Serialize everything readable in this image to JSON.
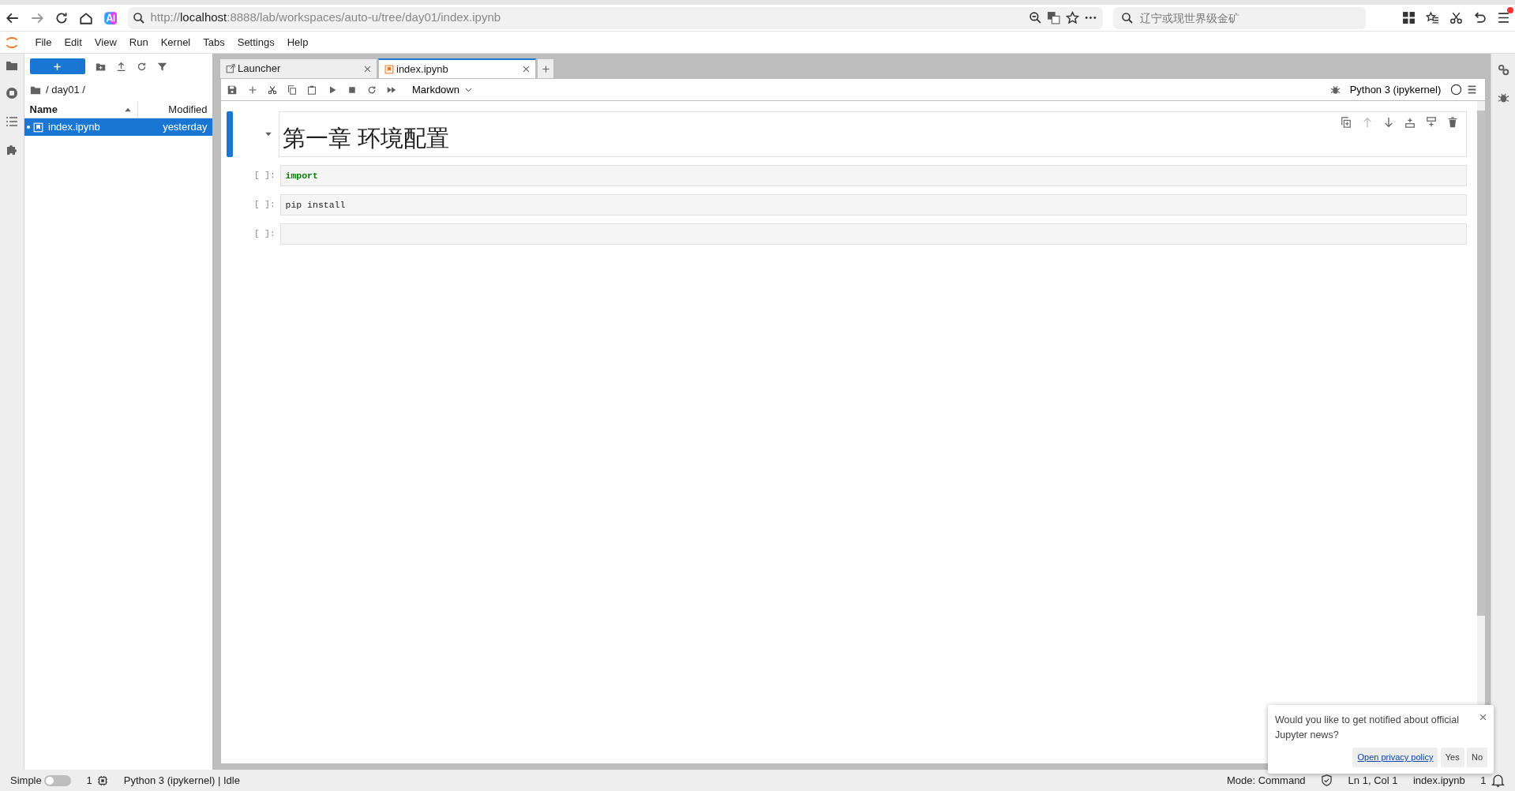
{
  "browser": {
    "address": {
      "scheme": "http://",
      "host": "localhost",
      "path": ":8888/lab/workspaces/auto-u/tree/day01/index.ipynb"
    },
    "search": {
      "placeholder": "辽宁或现世界级金矿"
    },
    "menu_badge": true
  },
  "menu": [
    "File",
    "Edit",
    "View",
    "Run",
    "Kernel",
    "Tabs",
    "Settings",
    "Help"
  ],
  "file_browser": {
    "breadcrumb": "/ day01 /",
    "columns": [
      {
        "label": "Name",
        "sorted": true
      },
      {
        "label": "Modified",
        "sorted": false
      }
    ],
    "files": [
      {
        "name": "index.ipynb",
        "modified": "yesterday",
        "selected": true,
        "running": true
      }
    ]
  },
  "tabs": [
    {
      "label": "Launcher",
      "kind": "launcher",
      "selected": false
    },
    {
      "label": "index.ipynb",
      "kind": "notebook",
      "selected": true
    }
  ],
  "toolbar": {
    "cell_type": "Markdown",
    "kernel": "Python 3 (ipykernel)"
  },
  "cells": [
    {
      "kind": "markdown",
      "text": "第一章 环境配置",
      "active": true
    },
    {
      "kind": "code",
      "prompt": "[ ]:",
      "code": "import",
      "syntax_highlighted": true,
      "active": false
    },
    {
      "kind": "code",
      "prompt": "[ ]:",
      "code": "pip install",
      "syntax_highlighted": false,
      "active": false
    },
    {
      "kind": "code",
      "prompt": "[ ]:",
      "active": false
    }
  ],
  "notification": {
    "message": "Would you like to get notified about official Jupyter news?",
    "link": "Open privacy policy",
    "buttons": [
      "Yes",
      "No"
    ]
  },
  "status_bar": {
    "simple_label": "Simple",
    "simple_on": false,
    "terminals": "1",
    "kernel_status": "Python 3 (ipykernel) | Idle",
    "mode": "Mode: Command",
    "position": "Ln 1, Col 1",
    "file": "index.ipynb",
    "notifications": "1"
  }
}
